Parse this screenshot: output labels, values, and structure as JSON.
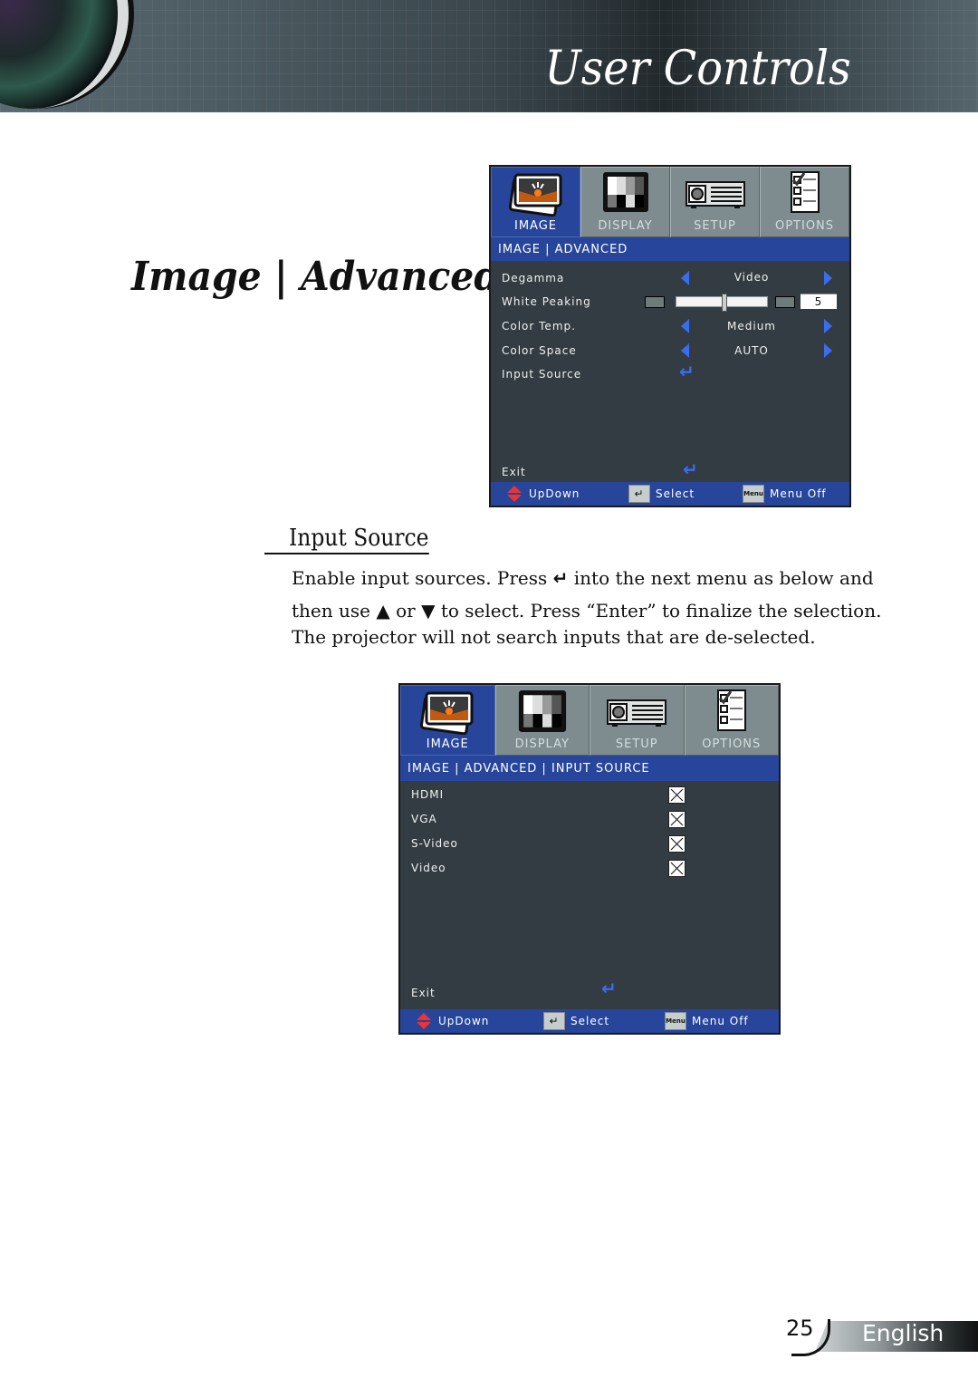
{
  "header": {
    "title": "User Controls"
  },
  "section": {
    "title": "Image | Advanced"
  },
  "osd_advanced": {
    "tabs": [
      {
        "label": "IMAGE",
        "icon": "image-icon",
        "active": true
      },
      {
        "label": "DISPLAY",
        "icon": "display-icon",
        "active": false
      },
      {
        "label": "SETUP",
        "icon": "projector-icon",
        "active": false
      },
      {
        "label": "OPTIONS",
        "icon": "checklist-icon",
        "active": false
      }
    ],
    "breadcrumb": "IMAGE | ADVANCED",
    "rows": [
      {
        "label": "Degamma",
        "value": "Video",
        "type": "select"
      },
      {
        "label": "White Peaking",
        "value": "5",
        "type": "slider",
        "level": 0.5
      },
      {
        "label": "Color Temp.",
        "value": "Medium",
        "type": "select"
      },
      {
        "label": "Color Space",
        "value": "AUTO",
        "type": "select"
      },
      {
        "label": "Input Source",
        "type": "enter"
      }
    ],
    "exit_label": "Exit",
    "footer": {
      "updown": "UpDown",
      "select": "Select",
      "menu_key": "Menu",
      "menu_off": "Menu Off"
    }
  },
  "input_source": {
    "heading": "Input Source",
    "para": [
      {
        "before": "Enable input sources. Press",
        "after": "into the next menu as below and"
      },
      {
        "before": "then use",
        "mid": "or",
        "after": "to select. Press “Enter” to finalize the selection."
      },
      {
        "text": "The projector will not search inputs that are de-selected."
      }
    ]
  },
  "osd_input": {
    "tabs": [
      {
        "label": "IMAGE",
        "active": true
      },
      {
        "label": "DISPLAY",
        "active": false
      },
      {
        "label": "SETUP",
        "active": false
      },
      {
        "label": "OPTIONS",
        "active": false
      }
    ],
    "breadcrumb": "IMAGE | ADVANCED | INPUT SOURCE",
    "sources": [
      {
        "label": "HDMI",
        "checked": true
      },
      {
        "label": "VGA",
        "checked": true
      },
      {
        "label": "S-Video",
        "checked": true
      },
      {
        "label": "Video",
        "checked": true
      }
    ],
    "exit_label": "Exit",
    "footer": {
      "updown": "UpDown",
      "select": "Select",
      "menu_key": "Menu",
      "menu_off": "Menu Off"
    }
  },
  "page_footer": {
    "page": "25",
    "language": "English"
  }
}
